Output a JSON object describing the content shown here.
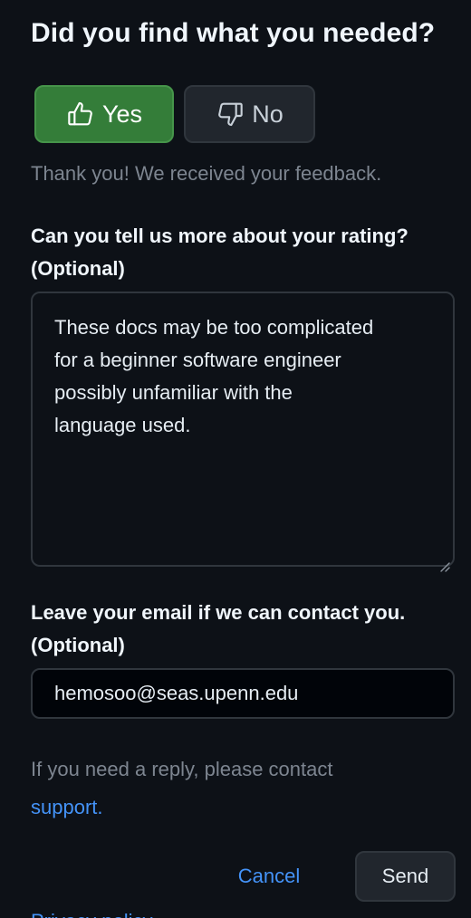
{
  "feedback": {
    "title": "Did you find what you needed?",
    "yes_label": "Yes",
    "no_label": "No",
    "thanks_message": "Thank you! We received your feedback.",
    "rating_label_line1": "Can you tell us more about your rating?",
    "rating_label_line2": "(Optional)",
    "rating_text": "These docs may be too complicated\nfor a beginner software engineer\npossibly unfamiliar with the\nlanguage used.",
    "email_label_line1": "Leave your email if we can contact you.",
    "email_label_line2": "(Optional)",
    "email_value": "hemosoo@seas.upenn.edu",
    "reply_note_prefix": "If you need a reply, please contact",
    "support_link": "support.",
    "cancel_label": "Cancel",
    "send_label": "Send",
    "privacy_link": "Privacy policy"
  },
  "icons": {
    "yes": "thumbs-up-icon",
    "no": "thumbs-down-icon",
    "resize": "resize-handle-icon"
  },
  "colors": {
    "background": "#0d1117",
    "yes_button": "#347d39",
    "link": "#4493f8",
    "muted_text": "#7d8590",
    "border": "#30363d"
  }
}
